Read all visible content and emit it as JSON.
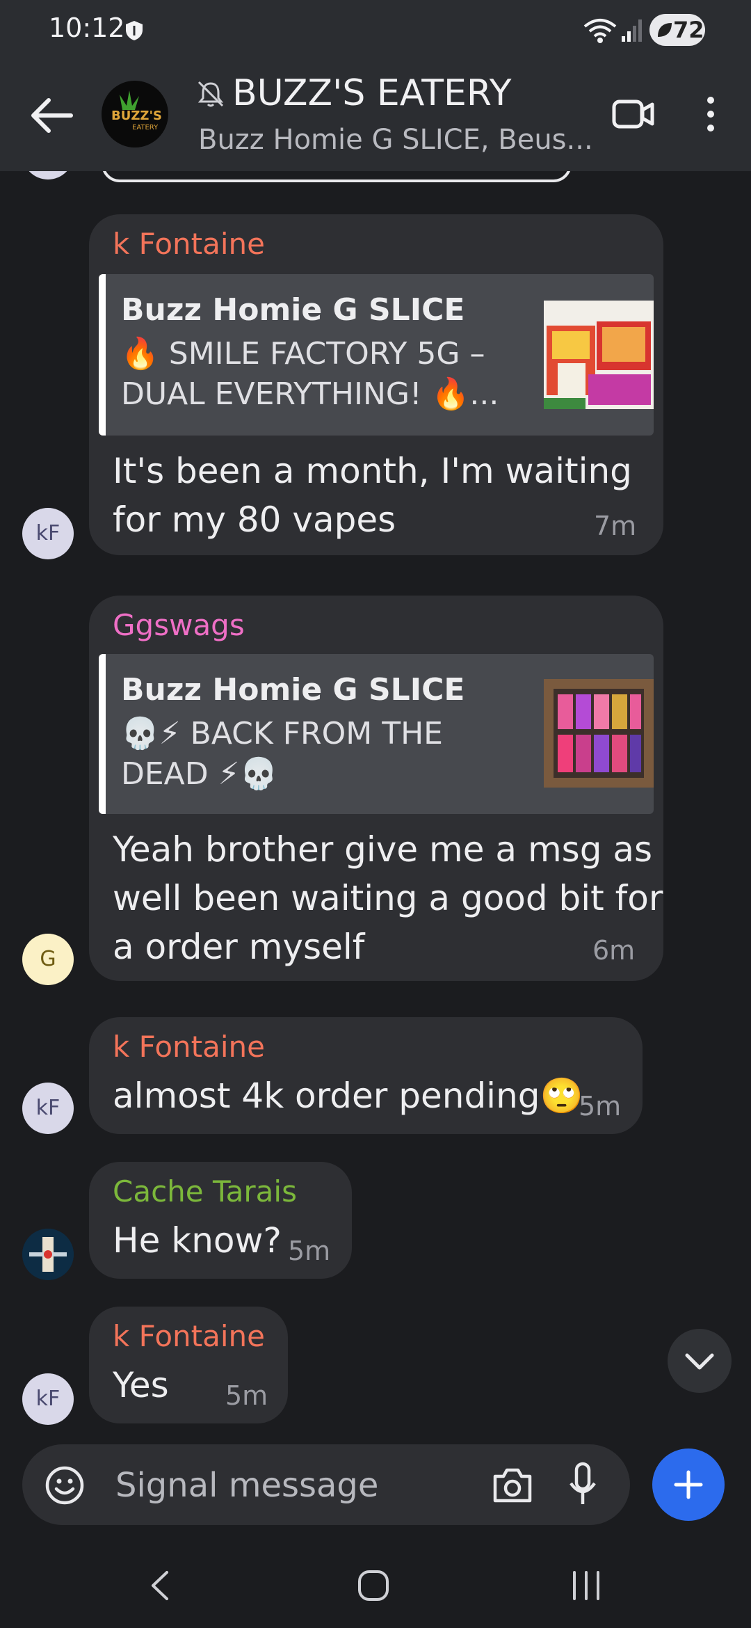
{
  "status_bar": {
    "time": "10:12",
    "battery": "72"
  },
  "header": {
    "title": "BUZZ'S EATERY",
    "subtitle": "Buzz Homie G SLICE, Beus...",
    "avatar_text": "BUZZ'S",
    "avatar_subtext": "EATERY"
  },
  "messages": [
    {
      "sender": "k Fontaine",
      "sender_color": "#f3745a",
      "quote_author": "Buzz Homie G SLICE",
      "quote_line1": "🔥 SMILE FACTORY 5G –",
      "quote_line2": "DUAL EVERYTHING! 🔥...",
      "body_line1": "It's been a month, I'm waiting",
      "body_line2": "for my 80 vapes",
      "time": "7m",
      "avatar": "kF"
    },
    {
      "sender": "Ggswags",
      "sender_color": "#ef6fc6",
      "quote_author": "Buzz Homie G SLICE",
      "quote_line1": "💀⚡ BACK FROM THE",
      "quote_line2": "DEAD ⚡💀",
      "body_line1": "Yeah brother give me a msg as",
      "body_line2": "well been waiting a good bit for",
      "body_line3": "a order myself",
      "time": "6m",
      "avatar": "G"
    },
    {
      "sender": "k Fontaine",
      "sender_color": "#f3745a",
      "body": "almost 4k order pending🙄",
      "time": "5m",
      "avatar": "kF"
    },
    {
      "sender": "Cache Tarais",
      "sender_color": "#7cb83b",
      "body": "He know?",
      "time": "5m"
    },
    {
      "sender": "k Fontaine",
      "sender_color": "#f3745a",
      "body": "Yes",
      "time": "5m",
      "avatar": "kF"
    }
  ],
  "composer": {
    "placeholder": "Signal message"
  },
  "colors": {
    "accent": "#2c6bed",
    "background": "#1b1c1f",
    "bubble": "#2e2f33"
  }
}
